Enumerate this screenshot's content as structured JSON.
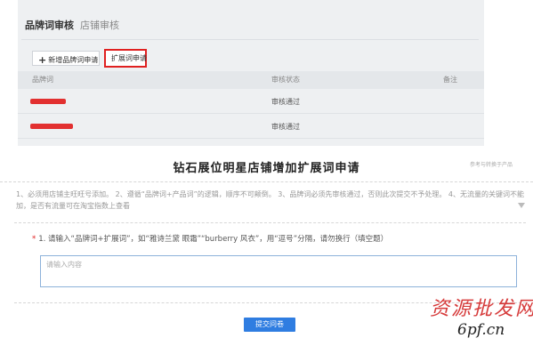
{
  "review": {
    "tabs": [
      {
        "label": "品牌词审核",
        "active": true
      },
      {
        "label": "店铺审核",
        "active": false
      }
    ],
    "buttons": {
      "add_label": "新增品牌词申请",
      "expand_label": "扩展词申请"
    },
    "table": {
      "headers": {
        "word": "品牌词",
        "status": "审核状态",
        "note": "备注"
      },
      "rows": [
        {
          "status": "审核通过"
        },
        {
          "status": "审核通过"
        }
      ]
    }
  },
  "form": {
    "title": "钻石展位明星店铺增加扩展词申请",
    "side_note": "参考与转换于产品",
    "description": "1、必须用店铺主旺旺号添加。 2、遵循“品牌词+产品词”的逻辑，顺序不可颠倒。 3、品牌词必须先审核通过，否则此次提交不予处理。 4、无流量的关键词不能加，是否有流量可在淘宝指数上查看",
    "question": {
      "required_mark": "*",
      "text": "1. 请输入“品牌词+扩展词”，如“雅诗兰黛 眼霜”“burberry 风衣”，用“逗号”分隔，请勿换行（填空题）"
    },
    "answer_placeholder": "请输入内容",
    "submit_label": "提交问卷"
  },
  "watermark": {
    "cn_text": "资源批发网",
    "url_text": "6pf.cn"
  },
  "colors": {
    "accent_red": "#e02020",
    "submit_blue": "#2f7de1",
    "panel_gray": "#eef0f2"
  }
}
